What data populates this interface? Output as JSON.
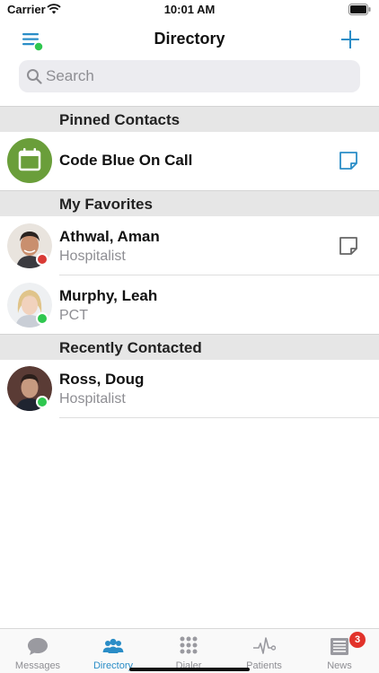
{
  "status": {
    "carrier": "Carrier",
    "time": "10:01 AM"
  },
  "nav": {
    "title": "Directory"
  },
  "search": {
    "placeholder": "Search",
    "value": ""
  },
  "sections": {
    "pinned": "Pinned Contacts",
    "favorites": "My Favorites",
    "recent": "Recently Contacted"
  },
  "contacts": {
    "code_blue": {
      "name": "Code Blue On Call"
    },
    "athwal": {
      "name": "Athwal, Aman",
      "role": "Hospitalist",
      "presence": "busy"
    },
    "murphy": {
      "name": "Murphy, Leah",
      "role": "PCT",
      "presence": "available"
    },
    "ross": {
      "name": "Ross, Doug",
      "role": "Hospitalist",
      "presence": "available"
    }
  },
  "tabs": {
    "messages": "Messages",
    "directory": "Directory",
    "dialer": "Dialer",
    "patients": "Patients",
    "news": "News",
    "news_badge": "3",
    "active": "directory"
  },
  "colors": {
    "accent": "#2a8dc7",
    "available": "#2fc74f",
    "busy": "#d93a35",
    "code_blue_avatar": "#6a9e3a"
  },
  "icons": [
    "menu-icon",
    "plus-icon",
    "search-icon",
    "calendar-icon",
    "note-icon",
    "chat-icon",
    "people-icon",
    "keypad-icon",
    "pulse-icon",
    "newspaper-icon"
  ]
}
